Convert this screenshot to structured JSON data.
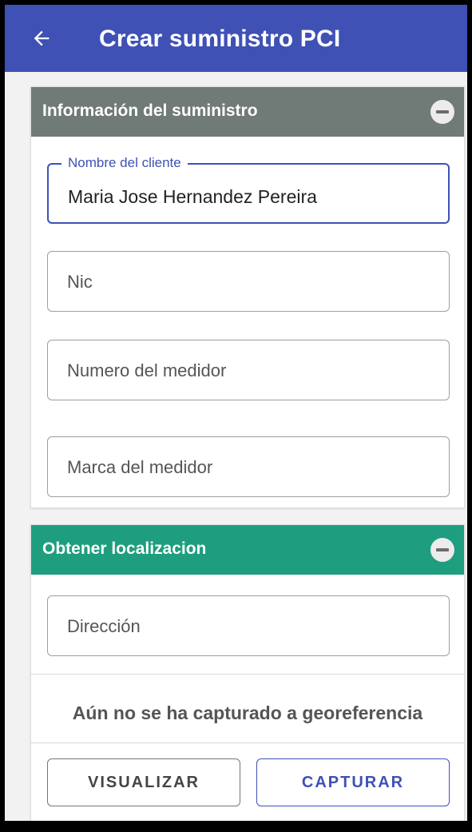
{
  "header": {
    "title": "Crear suministro PCI",
    "back_icon": "arrow-left-icon",
    "background_color": "#3f51b5"
  },
  "supply_section": {
    "title": "Información del suministro",
    "header_color": "#707a76",
    "collapse_icon": "minus-circle-icon",
    "fields": [
      {
        "label": "Nombre del cliente",
        "value": "Maria Jose Hernandez Pereira"
      },
      {
        "placeholder": "Nic"
      },
      {
        "placeholder": "Numero del medidor"
      },
      {
        "placeholder": "Marca del medidor"
      }
    ]
  },
  "location_section": {
    "title": "Obtener localizacion",
    "header_color": "#1e9e7e",
    "collapse_icon": "minus-circle-icon",
    "address_placeholder": "Dirección",
    "status": "Aún no se ha capturado a georeferencia",
    "buttons": {
      "view_label": "VISUALIZAR",
      "capture_label": "CAPTURAR"
    }
  }
}
